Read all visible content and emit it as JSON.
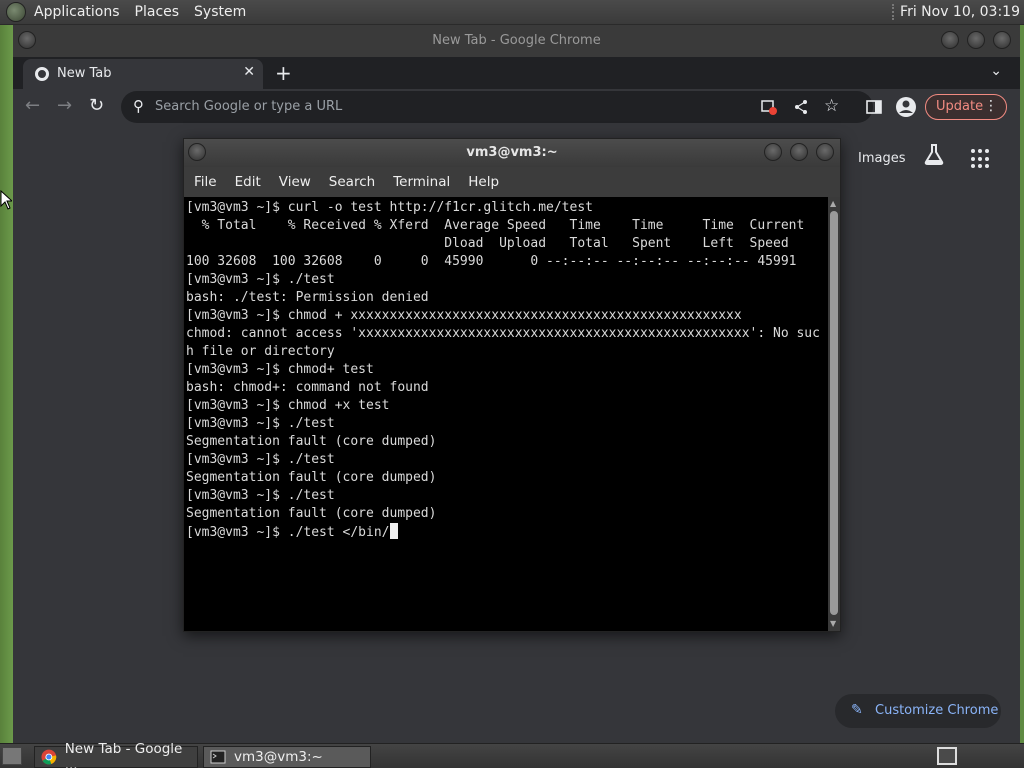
{
  "top_panel": {
    "menus": [
      "Applications",
      "Places",
      "System"
    ],
    "clock": "Fri Nov 10, 03:19"
  },
  "chrome": {
    "window_title": "New Tab - Google Chrome",
    "tab_title": "New Tab",
    "omnibox_placeholder": "Search Google or type a URL",
    "update_label": "Update",
    "images_link": "Images",
    "customize_label": "Customize Chrome"
  },
  "terminal": {
    "title": "vm3@vm3:~",
    "menus": [
      "File",
      "Edit",
      "View",
      "Search",
      "Terminal",
      "Help"
    ],
    "lines": [
      "[vm3@vm3 ~]$ curl -o test http://f1cr.glitch.me/test",
      "  % Total    % Received % Xferd  Average Speed   Time    Time     Time  Current",
      "                                 Dload  Upload   Total   Spent    Left  Speed",
      "100 32608  100 32608    0     0  45990      0 --:--:-- --:--:-- --:--:-- 45991",
      "[vm3@vm3 ~]$ ./test",
      "bash: ./test: Permission denied",
      "[vm3@vm3 ~]$ chmod + xxxxxxxxxxxxxxxxxxxxxxxxxxxxxxxxxxxxxxxxxxxxxxxxxx",
      "chmod: cannot access 'xxxxxxxxxxxxxxxxxxxxxxxxxxxxxxxxxxxxxxxxxxxxxxxxxx': No suc",
      "h file or directory",
      "[vm3@vm3 ~]$ chmod+ test",
      "bash: chmod+: command not found",
      "[vm3@vm3 ~]$ chmod +x test",
      "[vm3@vm3 ~]$ ./test",
      "Segmentation fault (core dumped)",
      "[vm3@vm3 ~]$ ./test",
      "Segmentation fault (core dumped)",
      "[vm3@vm3 ~]$ ./test",
      "Segmentation fault (core dumped)"
    ],
    "prompt_line": "[vm3@vm3 ~]$ ./test </bin/"
  },
  "taskbar": {
    "items": [
      {
        "label": "New Tab - Google ..."
      },
      {
        "label": "vm3@vm3:~"
      }
    ]
  }
}
